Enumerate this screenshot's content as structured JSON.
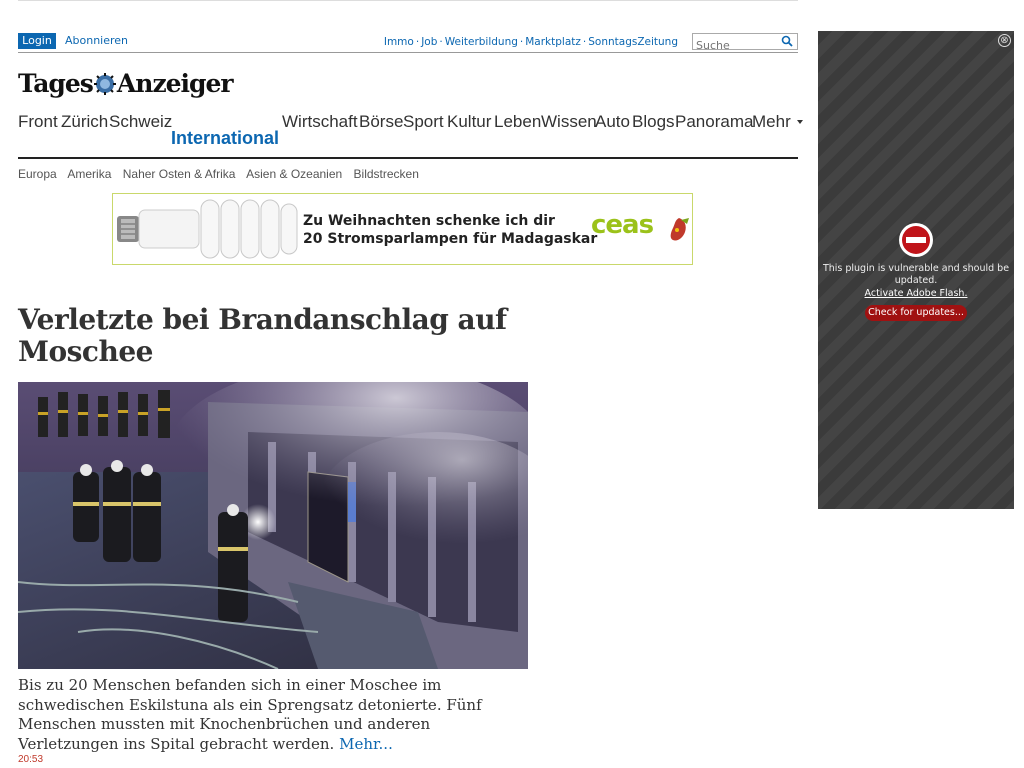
{
  "header": {
    "login_label": "Login",
    "subscribe_label": "Abonnieren",
    "util_links": [
      "Immo",
      "Job",
      "Weiterbildung",
      "Marktplatz",
      "SonntagsZeitung"
    ],
    "search_placeholder": "Suche",
    "logo_text_left": "Tages",
    "logo_text_right": "Anzeiger"
  },
  "mainnav": {
    "items": [
      "Front",
      "Zürich",
      "Schweiz",
      "International",
      "Wirtschaft",
      "Börse",
      "Sport",
      "Kultur",
      "Leben",
      "Wissen",
      "Auto",
      "Blogs",
      "Panorama",
      "Mehr"
    ],
    "active": "International"
  },
  "subnav": {
    "items": [
      "Europa",
      "Amerika",
      "Naher Osten & Afrika",
      "Asien & Ozeanien",
      "Bildstrecken"
    ]
  },
  "banner": {
    "line1": "Zu Weihnachten schenke ich dir",
    "line2": "20 Stromsparlampen für Madagaskar",
    "brand": "ceas"
  },
  "article": {
    "headline": "Verletzte bei Brandanschlag auf Moschee",
    "lead": "Bis zu 20 Menschen befanden sich in einer Moschee im schwedischen Eskilstuna als ein Sprengsatz detonierte. Fünf Menschen mussten mit Knochenbrüchen und anderen Verletzungen ins Spital gebracht werden.",
    "more_label": "Mehr...",
    "time": "20:53"
  },
  "plugin": {
    "message": "This plugin is vulnerable and should be updated.",
    "activate_label": "Activate Adobe Flash.",
    "check_label": "Check for updates...",
    "close_glyph": "⊗"
  },
  "colors": {
    "accent": "#0c67b1",
    "time": "#c0392b",
    "plugin_button": "#a01111",
    "banner_brand": "#9bc21a"
  }
}
